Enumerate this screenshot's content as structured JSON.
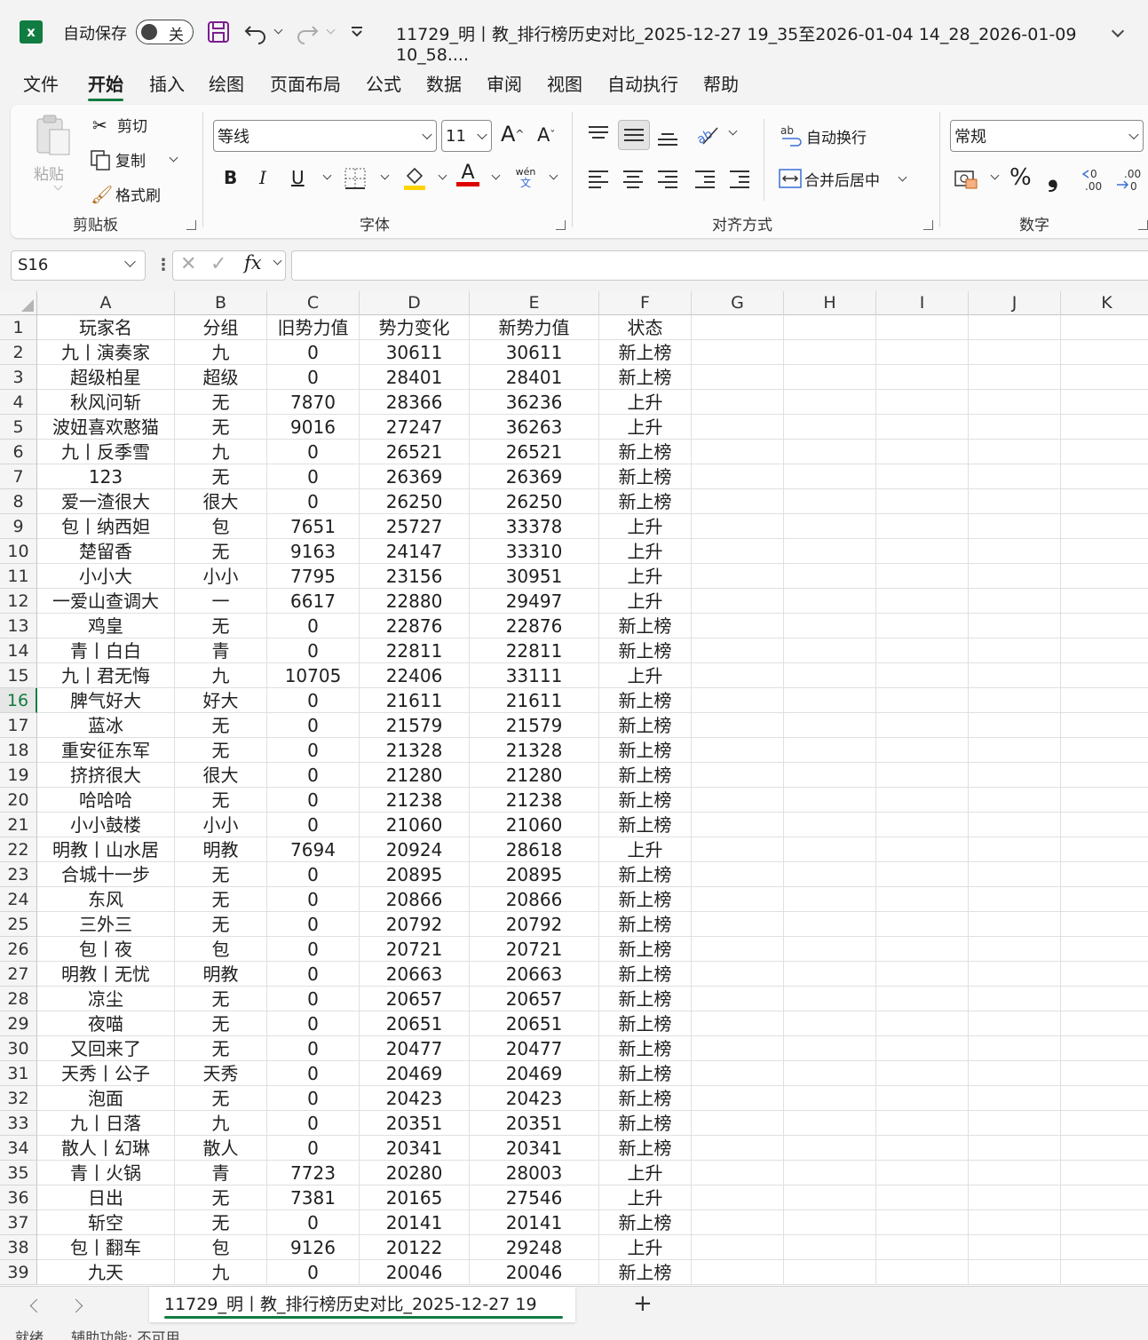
{
  "titlebar": {
    "autosave_label": "自动保存",
    "autosave_state": "关",
    "doc_title": "11729_明丨教_排行榜历史对比_2025-12-27 19_35至2026-01-04 14_28_2026-01-09 10_58...."
  },
  "menu": [
    "文件",
    "开始",
    "插入",
    "绘图",
    "页面布局",
    "公式",
    "数据",
    "审阅",
    "视图",
    "自动执行",
    "帮助"
  ],
  "menu_active": "开始",
  "ribbon": {
    "clipboard": {
      "paste": "粘贴",
      "cut": "剪切",
      "copy": "复制",
      "format_painter": "格式刷",
      "group": "剪贴板"
    },
    "font": {
      "name": "等线",
      "size": "11",
      "bold": "B",
      "italic": "I",
      "underline": "U",
      "group": "字体",
      "wen": "wén",
      "wen_sub": "文"
    },
    "alignment": {
      "wrap": "自动换行",
      "merge": "合并后居中",
      "group": "对齐方式"
    },
    "number": {
      "format": "常规",
      "percent": "%",
      "comma": "❟",
      "group": "数字"
    }
  },
  "formula": {
    "name_box": "S16",
    "fx": "fx",
    "value": ""
  },
  "sheet": {
    "columns": [
      "A",
      "B",
      "C",
      "D",
      "E",
      "F",
      "G",
      "H",
      "I",
      "J",
      "K"
    ],
    "rows": [
      [
        "玩家名",
        "分组",
        "旧势力值",
        "势力变化",
        "新势力值",
        "状态"
      ],
      [
        "九丨演奏家",
        "九",
        "0",
        "30611",
        "30611",
        "新上榜"
      ],
      [
        "超级柏星",
        "超级",
        "0",
        "28401",
        "28401",
        "新上榜"
      ],
      [
        "秋风问斩",
        "无",
        "7870",
        "28366",
        "36236",
        "上升"
      ],
      [
        "波妞喜欢憨猫",
        "无",
        "9016",
        "27247",
        "36263",
        "上升"
      ],
      [
        "九丨反季雪",
        "九",
        "0",
        "26521",
        "26521",
        "新上榜"
      ],
      [
        "123",
        "无",
        "0",
        "26369",
        "26369",
        "新上榜"
      ],
      [
        "爱一渣很大",
        "很大",
        "0",
        "26250",
        "26250",
        "新上榜"
      ],
      [
        "包丨纳西妲",
        "包",
        "7651",
        "25727",
        "33378",
        "上升"
      ],
      [
        "楚留香",
        "无",
        "9163",
        "24147",
        "33310",
        "上升"
      ],
      [
        "小小大",
        "小小",
        "7795",
        "23156",
        "30951",
        "上升"
      ],
      [
        "一爱山查调大",
        "一",
        "6617",
        "22880",
        "29497",
        "上升"
      ],
      [
        "鸡皇",
        "无",
        "0",
        "22876",
        "22876",
        "新上榜"
      ],
      [
        "青丨白白",
        "青",
        "0",
        "22811",
        "22811",
        "新上榜"
      ],
      [
        "九丨君无悔",
        "九",
        "10705",
        "22406",
        "33111",
        "上升"
      ],
      [
        "脾气好大",
        "好大",
        "0",
        "21611",
        "21611",
        "新上榜"
      ],
      [
        "蓝冰",
        "无",
        "0",
        "21579",
        "21579",
        "新上榜"
      ],
      [
        "重安征东军",
        "无",
        "0",
        "21328",
        "21328",
        "新上榜"
      ],
      [
        "挤挤很大",
        "很大",
        "0",
        "21280",
        "21280",
        "新上榜"
      ],
      [
        "哈哈哈",
        "无",
        "0",
        "21238",
        "21238",
        "新上榜"
      ],
      [
        "小小鼓楼",
        "小小",
        "0",
        "21060",
        "21060",
        "新上榜"
      ],
      [
        "明教丨山水居",
        "明教",
        "7694",
        "20924",
        "28618",
        "上升"
      ],
      [
        "合城十一步",
        "无",
        "0",
        "20895",
        "20895",
        "新上榜"
      ],
      [
        "东风",
        "无",
        "0",
        "20866",
        "20866",
        "新上榜"
      ],
      [
        "三外三",
        "无",
        "0",
        "20792",
        "20792",
        "新上榜"
      ],
      [
        "包丨夜",
        "包",
        "0",
        "20721",
        "20721",
        "新上榜"
      ],
      [
        "明教丨无忧",
        "明教",
        "0",
        "20663",
        "20663",
        "新上榜"
      ],
      [
        "凉尘",
        "无",
        "0",
        "20657",
        "20657",
        "新上榜"
      ],
      [
        "夜喵",
        "无",
        "0",
        "20651",
        "20651",
        "新上榜"
      ],
      [
        "又回来了",
        "无",
        "0",
        "20477",
        "20477",
        "新上榜"
      ],
      [
        "天秀丨公子",
        "天秀",
        "0",
        "20469",
        "20469",
        "新上榜"
      ],
      [
        "泡面",
        "无",
        "0",
        "20423",
        "20423",
        "新上榜"
      ],
      [
        "九丨日落",
        "九",
        "0",
        "20351",
        "20351",
        "新上榜"
      ],
      [
        "散人丨幻琳",
        "散人",
        "0",
        "20341",
        "20341",
        "新上榜"
      ],
      [
        "青丨火锅",
        "青",
        "7723",
        "20280",
        "28003",
        "上升"
      ],
      [
        "日出",
        "无",
        "7381",
        "20165",
        "27546",
        "上升"
      ],
      [
        "斩空",
        "无",
        "0",
        "20141",
        "20141",
        "新上榜"
      ],
      [
        "包丨翻车",
        "包",
        "9126",
        "20122",
        "29248",
        "上升"
      ],
      [
        "九天",
        "九",
        "0",
        "20046",
        "20046",
        "新上榜"
      ]
    ],
    "selected_row": 16
  },
  "tabs": {
    "sheet_name": "11729_明丨教_排行榜历史对比_2025-12-27 19",
    "add": "+"
  },
  "status": {
    "ready": "就绪",
    "accessibility": "辅助功能: 不可用"
  },
  "colors": {
    "accent": "#107c41",
    "font_red": "#e00000",
    "fill_yellow": "#ffd400"
  }
}
